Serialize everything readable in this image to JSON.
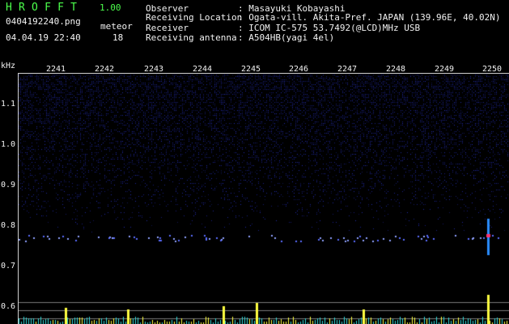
{
  "app": {
    "title": "HROFFT",
    "version": "1.00"
  },
  "file_name": "0404192240.png",
  "timestamp": "04.04.19 22:40",
  "meteor": {
    "label": "meteor",
    "count": "18"
  },
  "info": [
    {
      "label": "Observer",
      "value": ": Masayuki Kobayashi"
    },
    {
      "label": "Receiving Location",
      "value": ": Ogata-vill. Akita-Pref. JAPAN (139.96E, 40.02N)"
    },
    {
      "label": "Receiver",
      "value": ": ICOM IC-575 53.7492(@LCD)MHz USB"
    },
    {
      "label": "Receiving antenna",
      "value": ": A504HB(yagi 4el)"
    }
  ],
  "axis": {
    "y_unit": "kHz",
    "y_ticks": [
      "1.1",
      "1.0",
      "0.9",
      "0.8",
      "0.7",
      "0.6"
    ],
    "x_ticks": [
      "2241",
      "2242",
      "2243",
      "2244",
      "2245",
      "2246",
      "2247",
      "2248",
      "2249",
      "2250"
    ]
  },
  "colors": {
    "header_text": "#f2f2f2",
    "title_green": "#4cff4c",
    "background": "#000000",
    "noise": "#1a1a80",
    "echo": "#ff3070",
    "amplitude": "#ffff40"
  }
}
